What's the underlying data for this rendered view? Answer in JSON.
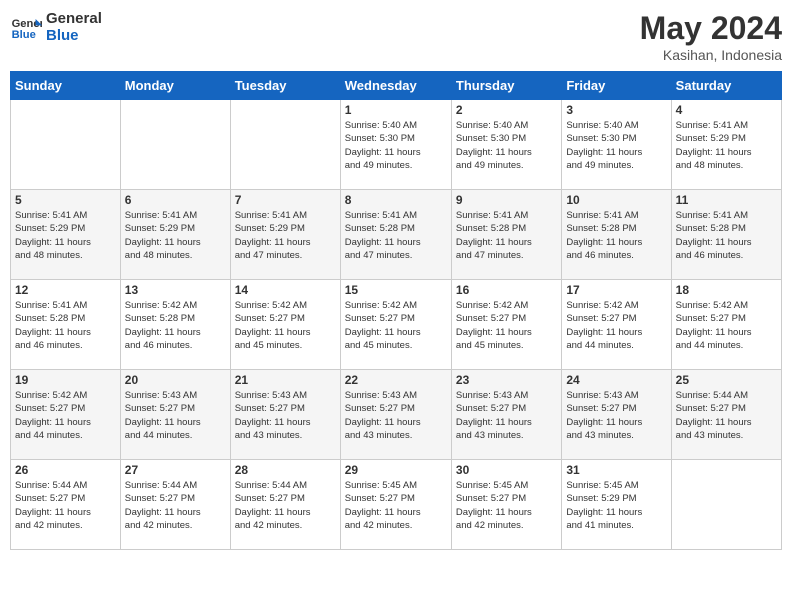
{
  "header": {
    "logo_general": "General",
    "logo_blue": "Blue",
    "month_title": "May 2024",
    "location": "Kasihan, Indonesia"
  },
  "days_of_week": [
    "Sunday",
    "Monday",
    "Tuesday",
    "Wednesday",
    "Thursday",
    "Friday",
    "Saturday"
  ],
  "weeks": [
    [
      {
        "day": "",
        "info": ""
      },
      {
        "day": "",
        "info": ""
      },
      {
        "day": "",
        "info": ""
      },
      {
        "day": "1",
        "info": "Sunrise: 5:40 AM\nSunset: 5:30 PM\nDaylight: 11 hours\nand 49 minutes."
      },
      {
        "day": "2",
        "info": "Sunrise: 5:40 AM\nSunset: 5:30 PM\nDaylight: 11 hours\nand 49 minutes."
      },
      {
        "day": "3",
        "info": "Sunrise: 5:40 AM\nSunset: 5:30 PM\nDaylight: 11 hours\nand 49 minutes."
      },
      {
        "day": "4",
        "info": "Sunrise: 5:41 AM\nSunset: 5:29 PM\nDaylight: 11 hours\nand 48 minutes."
      }
    ],
    [
      {
        "day": "5",
        "info": "Sunrise: 5:41 AM\nSunset: 5:29 PM\nDaylight: 11 hours\nand 48 minutes."
      },
      {
        "day": "6",
        "info": "Sunrise: 5:41 AM\nSunset: 5:29 PM\nDaylight: 11 hours\nand 48 minutes."
      },
      {
        "day": "7",
        "info": "Sunrise: 5:41 AM\nSunset: 5:29 PM\nDaylight: 11 hours\nand 47 minutes."
      },
      {
        "day": "8",
        "info": "Sunrise: 5:41 AM\nSunset: 5:28 PM\nDaylight: 11 hours\nand 47 minutes."
      },
      {
        "day": "9",
        "info": "Sunrise: 5:41 AM\nSunset: 5:28 PM\nDaylight: 11 hours\nand 47 minutes."
      },
      {
        "day": "10",
        "info": "Sunrise: 5:41 AM\nSunset: 5:28 PM\nDaylight: 11 hours\nand 46 minutes."
      },
      {
        "day": "11",
        "info": "Sunrise: 5:41 AM\nSunset: 5:28 PM\nDaylight: 11 hours\nand 46 minutes."
      }
    ],
    [
      {
        "day": "12",
        "info": "Sunrise: 5:41 AM\nSunset: 5:28 PM\nDaylight: 11 hours\nand 46 minutes."
      },
      {
        "day": "13",
        "info": "Sunrise: 5:42 AM\nSunset: 5:28 PM\nDaylight: 11 hours\nand 46 minutes."
      },
      {
        "day": "14",
        "info": "Sunrise: 5:42 AM\nSunset: 5:27 PM\nDaylight: 11 hours\nand 45 minutes."
      },
      {
        "day": "15",
        "info": "Sunrise: 5:42 AM\nSunset: 5:27 PM\nDaylight: 11 hours\nand 45 minutes."
      },
      {
        "day": "16",
        "info": "Sunrise: 5:42 AM\nSunset: 5:27 PM\nDaylight: 11 hours\nand 45 minutes."
      },
      {
        "day": "17",
        "info": "Sunrise: 5:42 AM\nSunset: 5:27 PM\nDaylight: 11 hours\nand 44 minutes."
      },
      {
        "day": "18",
        "info": "Sunrise: 5:42 AM\nSunset: 5:27 PM\nDaylight: 11 hours\nand 44 minutes."
      }
    ],
    [
      {
        "day": "19",
        "info": "Sunrise: 5:42 AM\nSunset: 5:27 PM\nDaylight: 11 hours\nand 44 minutes."
      },
      {
        "day": "20",
        "info": "Sunrise: 5:43 AM\nSunset: 5:27 PM\nDaylight: 11 hours\nand 44 minutes."
      },
      {
        "day": "21",
        "info": "Sunrise: 5:43 AM\nSunset: 5:27 PM\nDaylight: 11 hours\nand 43 minutes."
      },
      {
        "day": "22",
        "info": "Sunrise: 5:43 AM\nSunset: 5:27 PM\nDaylight: 11 hours\nand 43 minutes."
      },
      {
        "day": "23",
        "info": "Sunrise: 5:43 AM\nSunset: 5:27 PM\nDaylight: 11 hours\nand 43 minutes."
      },
      {
        "day": "24",
        "info": "Sunrise: 5:43 AM\nSunset: 5:27 PM\nDaylight: 11 hours\nand 43 minutes."
      },
      {
        "day": "25",
        "info": "Sunrise: 5:44 AM\nSunset: 5:27 PM\nDaylight: 11 hours\nand 43 minutes."
      }
    ],
    [
      {
        "day": "26",
        "info": "Sunrise: 5:44 AM\nSunset: 5:27 PM\nDaylight: 11 hours\nand 42 minutes."
      },
      {
        "day": "27",
        "info": "Sunrise: 5:44 AM\nSunset: 5:27 PM\nDaylight: 11 hours\nand 42 minutes."
      },
      {
        "day": "28",
        "info": "Sunrise: 5:44 AM\nSunset: 5:27 PM\nDaylight: 11 hours\nand 42 minutes."
      },
      {
        "day": "29",
        "info": "Sunrise: 5:45 AM\nSunset: 5:27 PM\nDaylight: 11 hours\nand 42 minutes."
      },
      {
        "day": "30",
        "info": "Sunrise: 5:45 AM\nSunset: 5:27 PM\nDaylight: 11 hours\nand 42 minutes."
      },
      {
        "day": "31",
        "info": "Sunrise: 5:45 AM\nSunset: 5:29 PM\nDaylight: 11 hours\nand 41 minutes."
      },
      {
        "day": "",
        "info": ""
      }
    ]
  ]
}
